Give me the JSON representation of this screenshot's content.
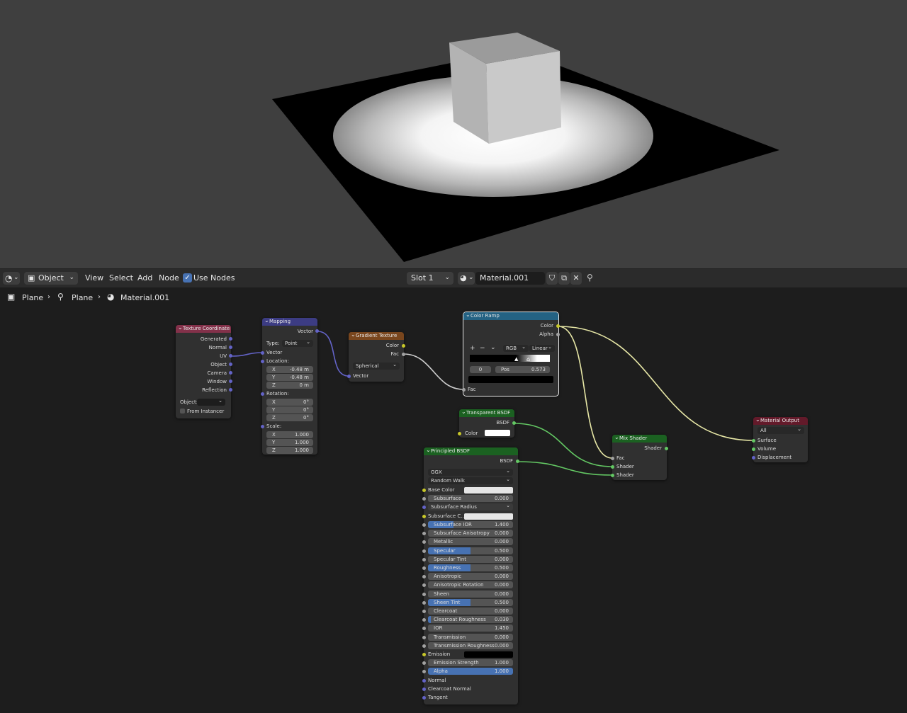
{
  "header": {
    "mode": "Object",
    "menus": [
      "View",
      "Select",
      "Add",
      "Node"
    ],
    "use_nodes_label": "Use Nodes",
    "slot": "Slot 1",
    "material_name": "Material.001"
  },
  "breadcrumb": {
    "object": "Plane",
    "mesh": "Plane",
    "material": "Material.001"
  },
  "colors": {
    "texture_coordinate_header": "#83314a",
    "mapping_header": "#3c3c83",
    "gradient_header": "#79461d",
    "color_ramp_header": "#246283",
    "shader_header": "#1b6121",
    "output_header": "#631a2a",
    "viewport_bg": "#3f3f3f",
    "editor_bg": "#1d1d1d"
  },
  "nodes": {
    "texture_coordinate": {
      "title": "Texture Coordinate",
      "outputs": [
        "Generated",
        "Normal",
        "UV",
        "Object",
        "Camera",
        "Window",
        "Reflection"
      ],
      "object_label": "Object:",
      "from_instancer": "From Instancer"
    },
    "mapping": {
      "title": "Mapping",
      "output": "Vector",
      "type_label": "Type:",
      "type_value": "Point",
      "vector_label": "Vector",
      "location_label": "Location:",
      "location": [
        {
          "axis": "X",
          "value": "-0.48 m"
        },
        {
          "axis": "Y",
          "value": "-0.48 m"
        },
        {
          "axis": "Z",
          "value": "0 m"
        }
      ],
      "rotation_label": "Rotation:",
      "rotation": [
        {
          "axis": "X",
          "value": "0°"
        },
        {
          "axis": "Y",
          "value": "0°"
        },
        {
          "axis": "Z",
          "value": "0°"
        }
      ],
      "scale_label": "Scale:",
      "scale": [
        {
          "axis": "X",
          "value": "1.000"
        },
        {
          "axis": "Y",
          "value": "1.000"
        },
        {
          "axis": "Z",
          "value": "1.000"
        }
      ]
    },
    "gradient_texture": {
      "title": "Gradient Texture",
      "outputs": [
        "Color",
        "Fac"
      ],
      "type_value": "Spherical",
      "input": "Vector"
    },
    "color_ramp": {
      "title": "Color Ramp",
      "outputs": [
        "Color",
        "Alpha"
      ],
      "plus": "+",
      "minus": "−",
      "chev": "⌄",
      "color_mode": "RGB",
      "interpolation": "Linear",
      "stop_index": "0",
      "pos_label": "Pos",
      "pos_value": "0.573",
      "input": "Fac"
    },
    "transparent_bsdf": {
      "title": "Transparent BSDF",
      "output": "BSDF",
      "color_label": "Color"
    },
    "principled_bsdf": {
      "title": "Principled BSDF",
      "output": "BSDF",
      "distribution": "GGX",
      "subsurface_method": "Random Walk",
      "base_color_label": "Base Color",
      "subsurface_label": "Subsurface",
      "subsurface_value": "0.000",
      "subsurface_radius_label": "Subsurface Radius",
      "subsurface_color_label": "Subsurface C...",
      "fields": [
        {
          "label": "Subsurface IOR",
          "value": "1.400",
          "fill": 0.3
        },
        {
          "label": "Subsurface Anisotropy",
          "value": "0.000",
          "fill": 0
        },
        {
          "label": "Metallic",
          "value": "0.000",
          "fill": 0
        },
        {
          "label": "Specular",
          "value": "0.500",
          "fill": 0.5
        },
        {
          "label": "Specular Tint",
          "value": "0.000",
          "fill": 0
        },
        {
          "label": "Roughness",
          "value": "0.500",
          "fill": 0.5
        },
        {
          "label": "Anisotropic",
          "value": "0.000",
          "fill": 0
        },
        {
          "label": "Anisotropic Rotation",
          "value": "0.000",
          "fill": 0
        },
        {
          "label": "Sheen",
          "value": "0.000",
          "fill": 0
        },
        {
          "label": "Sheen Tint",
          "value": "0.500",
          "fill": 0.5
        },
        {
          "label": "Clearcoat",
          "value": "0.000",
          "fill": 0
        },
        {
          "label": "Clearcoat Roughness",
          "value": "0.030",
          "fill": 0.03
        },
        {
          "label": "IOR",
          "value": "1.450",
          "fill": 0
        },
        {
          "label": "Transmission",
          "value": "0.000",
          "fill": 0
        },
        {
          "label": "Transmission Roughness",
          "value": "0.000",
          "fill": 0
        }
      ],
      "emission_label": "Emission",
      "emission_strength_label": "Emission Strength",
      "emission_strength_value": "1.000",
      "alpha_label": "Alpha",
      "alpha_value": "1.000",
      "normal_label": "Normal",
      "clearcoat_normal_label": "Clearcoat Normal",
      "tangent_label": "Tangent"
    },
    "mix_shader": {
      "title": "Mix Shader",
      "output": "Shader",
      "inputs": [
        "Fac",
        "Shader",
        "Shader"
      ]
    },
    "material_output": {
      "title": "Material Output",
      "target": "All",
      "inputs": [
        "Surface",
        "Volume",
        "Displacement"
      ]
    }
  }
}
